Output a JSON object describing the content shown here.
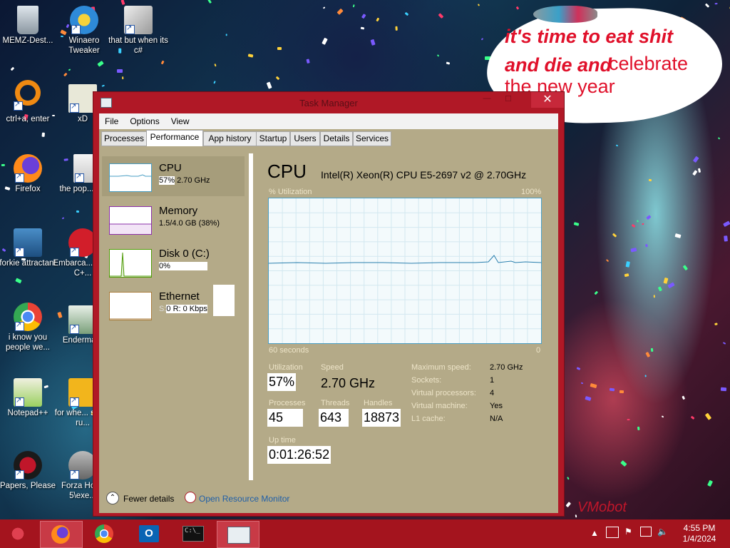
{
  "desktop": {
    "icons": [
      {
        "label": "MEMZ-Dest...",
        "icon": "recycle-bin-icon"
      },
      {
        "label": "Winaero Tweaker",
        "icon": "winaero-icon"
      },
      {
        "label": "that but when its c#",
        "icon": "stacked-windows-icon"
      },
      {
        "label": "ctrl+a, enter",
        "icon": "orange-ring-icon"
      },
      {
        "label": "xD",
        "icon": "hxd-icon"
      },
      {
        "label": "Firefox",
        "icon": "firefox-icon"
      },
      {
        "label": "the pop... shit",
        "icon": "video-file-icon"
      },
      {
        "label": "forkie attractant",
        "icon": "gear-monitor-icon"
      },
      {
        "label": "Embarca... Dev-C+...",
        "icon": "devcpp-icon"
      },
      {
        "label": "i know you people we...",
        "icon": "chrome-icon"
      },
      {
        "label": "Enderma...",
        "icon": "window-app-icon"
      },
      {
        "label": "Notepad++",
        "icon": "notepadpp-icon"
      },
      {
        "label": "for whe... some ru...",
        "icon": "dl-app-icon"
      },
      {
        "label": "Papers, Please",
        "icon": "papers-please-icon"
      },
      {
        "label": "Forza Hor... 5\\exe...",
        "icon": "flash-icon"
      }
    ],
    "meme": {
      "line1": "it's time to eat shit",
      "line2a": "and die and",
      "line2b": "celebrate",
      "line3": "the new year"
    },
    "watermark": "VMobot"
  },
  "window": {
    "title": "Task Manager",
    "close_glyph": "✕",
    "min_glyph": "—",
    "max_glyph": "☐",
    "menu": [
      "File",
      "Options",
      "View"
    ],
    "tabs": [
      "Processes",
      "Performance",
      "App history",
      "Startup",
      "Users",
      "Details",
      "Services"
    ],
    "active_tab": "Performance"
  },
  "resources": [
    {
      "name": "CPU",
      "sub_value": "57%",
      "sub_rest": "2.70 GHz",
      "color": "#4a9fc4"
    },
    {
      "name": "Memory",
      "sub_value": "1.5/4.0 GB (38%)",
      "sub_rest": "",
      "color": "#8b2fa8"
    },
    {
      "name": "Disk 0 (C:)",
      "sub_value": "0%",
      "sub_rest": "",
      "color": "#4e9a06"
    },
    {
      "name": "Ethernet",
      "sub_prefix": "S:",
      "sub_value": "0 R: 0 Kbps",
      "sub_rest": "",
      "color": "#a87b3a"
    }
  ],
  "cpu": {
    "title": "CPU",
    "model": "Intel(R) Xeon(R) CPU E5-2697 v2 @ 2.70GHz",
    "graph_label": "% Utilization",
    "graph_max": "100%",
    "graph_time": "60 seconds",
    "graph_min": "0",
    "utilization_label": "Utilization",
    "utilization": "57%",
    "speed_label": "Speed",
    "speed": "2.70 GHz",
    "processes_label": "Processes",
    "processes": "45",
    "threads_label": "Threads",
    "threads": "643",
    "handles_label": "Handles",
    "handles": "18873",
    "uptime_label": "Up time",
    "uptime": "0:01:26:52",
    "details": [
      {
        "k": "Maximum speed:",
        "v": "2.70 GHz"
      },
      {
        "k": "Sockets:",
        "v": "1"
      },
      {
        "k": "Virtual processors:",
        "v": "4"
      },
      {
        "k": "Virtual machine:",
        "v": "Yes"
      },
      {
        "k": "L1 cache:",
        "v": "N/A"
      }
    ]
  },
  "footer": {
    "fewer_details": "Fewer details",
    "open_resource_monitor": "Open Resource Monitor"
  },
  "taskbar": {
    "apps": [
      "firefox-icon",
      "chrome-icon",
      "outlook-icon",
      "cmd-icon",
      "task-manager-icon"
    ],
    "time": "4:55 PM",
    "date": "1/4/2024"
  }
}
